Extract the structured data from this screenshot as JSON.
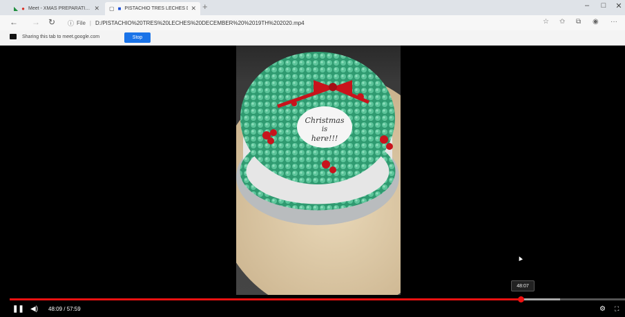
{
  "browser": {
    "tabs": [
      {
        "title": "Meet - XMAS PREPARATI…",
        "recording": true
      },
      {
        "title": "PISTACHIO TRES LECHES D…",
        "active": true
      }
    ],
    "new_tab_label": "+",
    "window_controls": {
      "minimize": "–",
      "restore": "□",
      "close": "✕"
    },
    "address": {
      "scheme_label": "File",
      "url": "D:/PISTACHIO%20TRES%20LECHES%20DECEMBER%20%2019TH%202020.mp4"
    },
    "toolbar_icons": [
      "star-icon",
      "favorites-icon",
      "collections-icon",
      "profile-icon",
      "more-icon"
    ]
  },
  "share_banner": {
    "text": "Sharing this tab to meet.google.com",
    "stop_label": "Stop"
  },
  "video": {
    "cake_text": "Christmas is here!!!",
    "hover_time": "48:07",
    "current_time": "48:09",
    "duration": "57:59",
    "time_display": "48:09 / 57:59",
    "progress_fraction": 0.83,
    "buffered_fraction": 0.895,
    "colors": {
      "progress": "#ee1111",
      "frosting": "#3aa57a",
      "bow": "#c8131c"
    }
  }
}
